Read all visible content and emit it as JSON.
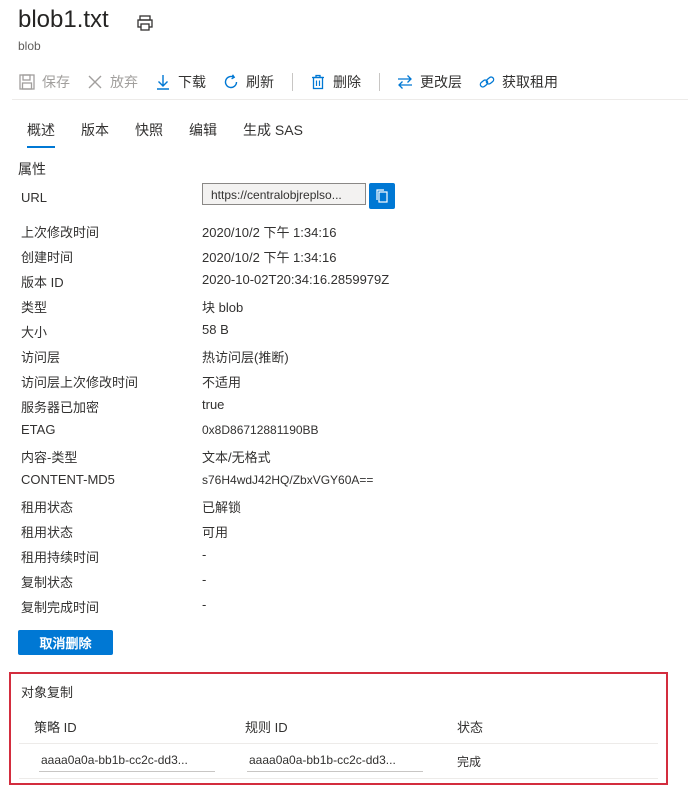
{
  "header": {
    "title": "blob1.txt",
    "subtitle": "blob",
    "print_icon": "print-icon"
  },
  "toolbar": {
    "save": {
      "label": "保存",
      "icon": "save-icon",
      "enabled": false
    },
    "discard": {
      "label": "放弃",
      "icon": "close-icon",
      "enabled": false
    },
    "download": {
      "label": "下载",
      "icon": "download-icon"
    },
    "refresh": {
      "label": "刷新",
      "icon": "refresh-icon"
    },
    "delete": {
      "label": "删除",
      "icon": "trash-icon"
    },
    "change_tier": {
      "label": "更改层",
      "icon": "swap-icon"
    },
    "acquire_lease": {
      "label": "获取租用",
      "icon": "link-icon"
    }
  },
  "tabs": [
    {
      "label": "概述",
      "active": true
    },
    {
      "label": "版本"
    },
    {
      "label": "快照"
    },
    {
      "label": "编辑"
    },
    {
      "label": "生成 SAS"
    }
  ],
  "properties": {
    "section_title": "属性",
    "url_label": "URL",
    "url_value": "https://centralobjreplso...",
    "rows": [
      {
        "label": "上次修改时间",
        "value": "2020/10/2 下午 1:34:16"
      },
      {
        "label": "创建时间",
        "value": "2020/10/2 下午 1:34:16"
      },
      {
        "label": "版本 ID",
        "value": "2020-10-02T20:34:16.2859979Z"
      },
      {
        "label": "类型",
        "value": "块 blob"
      },
      {
        "label": "大小",
        "value": "58 B"
      },
      {
        "label": "访问层",
        "value": "热访问层(推断)"
      },
      {
        "label": "访问层上次修改时间",
        "value": "不适用"
      },
      {
        "label": "服务器已加密",
        "value": "true"
      },
      {
        "label": "ETAG",
        "value": "0x8D86712881190BB"
      },
      {
        "label": "内容-类型",
        "value": "文本/无格式"
      },
      {
        "label": "CONTENT-MD5",
        "value": "s76H4wdJ42HQ/ZbxVGY60A=="
      },
      {
        "label": "租用状态",
        "value": "已解锁"
      },
      {
        "label": "租用状态",
        "value": "可用"
      },
      {
        "label": "租用持续时间",
        "value": "-"
      },
      {
        "label": "复制状态",
        "value": "-"
      },
      {
        "label": "复制完成时间",
        "value": "-"
      }
    ]
  },
  "undelete_button": "取消删除",
  "object_replication": {
    "title": "对象复制",
    "columns": [
      "策略 ID",
      "规则 ID",
      "状态"
    ],
    "row": [
      "aaaa0a0a-bb1b-cc2c-dd3...",
      "aaaa0a0a-bb1b-cc2c-dd3...",
      "完成"
    ]
  },
  "colors": {
    "accent": "#0078d4",
    "highlight_border": "#d32d3e"
  }
}
